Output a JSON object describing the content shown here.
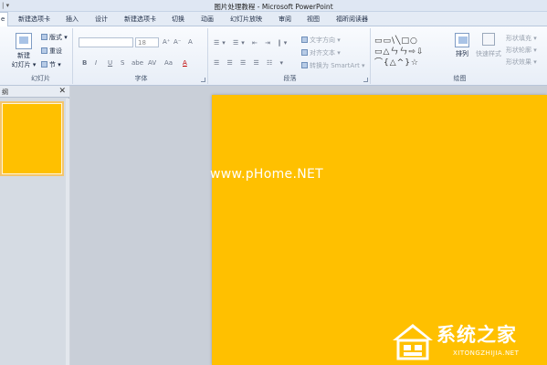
{
  "window": {
    "qat": "| ▾",
    "title": "图片处理教程 - Microsoft PowerPoint"
  },
  "tabs": [
    "e",
    "新建选项卡",
    "插入",
    "设计",
    "新建选项卡",
    "切换",
    "动画",
    "幻灯片放映",
    "审阅",
    "视图",
    "福昕阅读器"
  ],
  "ribbon": {
    "slides": {
      "label": "幻灯片",
      "new_slide": "新建",
      "new_slide_sub": "幻灯片 ▾",
      "layout": "版式 ▾",
      "reset": "重设",
      "section": "节 ▾"
    },
    "font": {
      "label": "字体",
      "size_value": "18",
      "bold": "B",
      "italic": "I",
      "underline": "U",
      "strike": "S",
      "abc": "abe",
      "spacing": "AV",
      "case": "Aa",
      "grow": "A⁺",
      "shrink": "A⁻",
      "clear": "A"
    },
    "paragraph": {
      "label": "段落",
      "text_direction": "文字方向 ▾",
      "align_text": "对齐文本 ▾",
      "smartart": "转换为 SmartArt ▾"
    },
    "drawing": {
      "label": "绘图",
      "shapes_row1": "▭▭\\╲□○",
      "shapes_row2": "▭△ㄣㄣ⇨⇩",
      "shapes_row3": "⌒{△^}☆",
      "arrange": "排列",
      "quick_styles": "快速样式",
      "fill": "形状填充 ▾",
      "outline": "形状轮廓 ▾",
      "effects": "形状效果 ▾"
    }
  },
  "panel": {
    "tab_label": "纲",
    "close": "✕"
  },
  "watermark": {
    "center": "www.pHome.NET",
    "site_title": "系统之家",
    "site_sub": "XITONGZHIJIA.NET"
  },
  "colors": {
    "slide_background": "#ffc000",
    "ribbon": "#eef3fa"
  }
}
